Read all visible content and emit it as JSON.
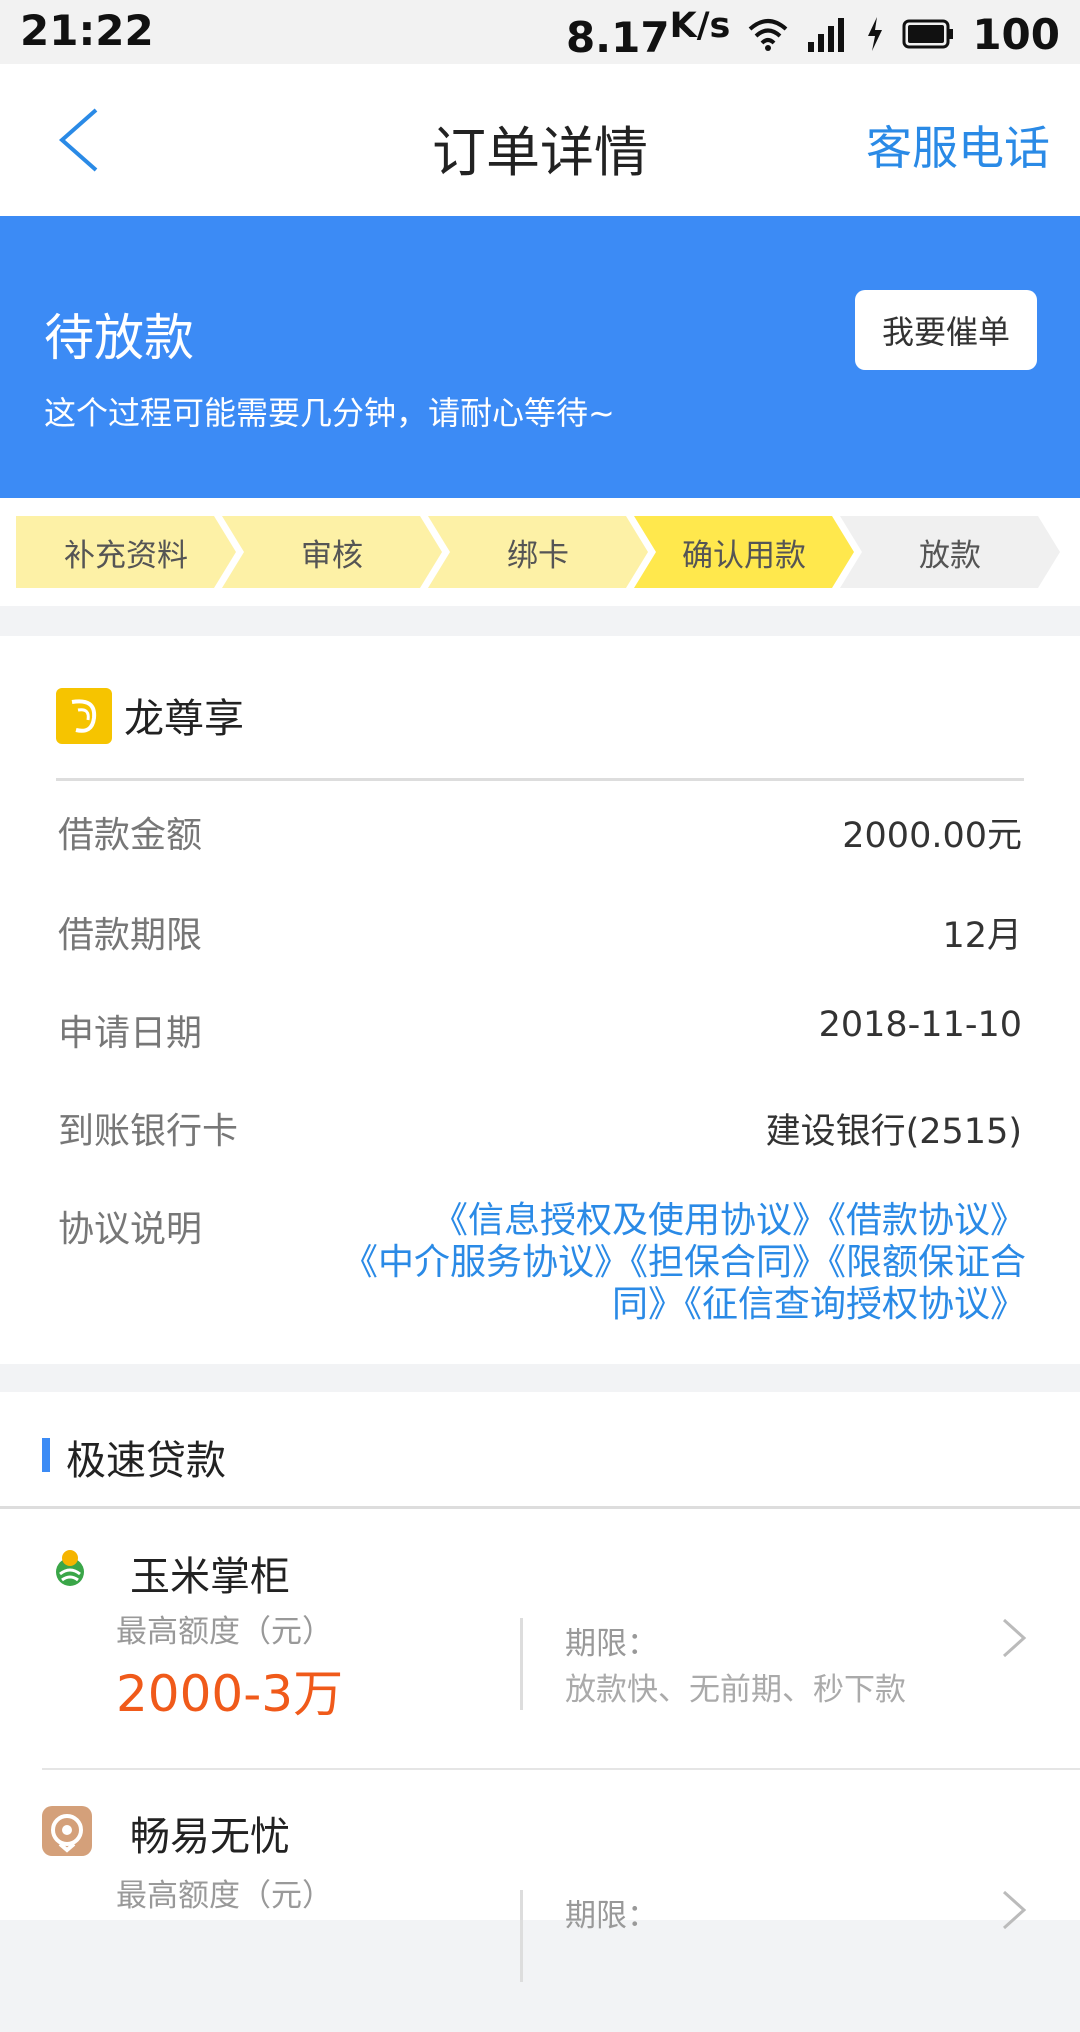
{
  "statusbar": {
    "time": "21:22",
    "speed": "8.17",
    "speed_unit": "K/s",
    "battery": "100"
  },
  "nav": {
    "title": "订单详情",
    "service_label": "客服电话"
  },
  "banner": {
    "title": "待放款",
    "desc": "这个过程可能需要几分钟，请耐心等待~",
    "urge_label": "我要催单",
    "color": "#3c8bf5"
  },
  "steps": [
    {
      "label": "补充资料",
      "state": "done"
    },
    {
      "label": "审核",
      "state": "done"
    },
    {
      "label": "绑卡",
      "state": "done"
    },
    {
      "label": "确认用款",
      "state": "current"
    },
    {
      "label": "放款",
      "state": "pending"
    }
  ],
  "order": {
    "product_name": "龙尊享",
    "rows": [
      {
        "label": "借款金额",
        "value": "2000.00元"
      },
      {
        "label": "借款期限",
        "value": "12月"
      },
      {
        "label": "申请日期",
        "value": "2018-11-10"
      },
      {
        "label": "到账银行卡",
        "value": "建设银行(2515)"
      }
    ],
    "agreement_label": "协议说明",
    "agreements": [
      "《信息授权及使用协议》",
      "《借款协议》",
      "《中介服务协议》",
      "《担保合同》",
      "《限额保证合同》",
      "《征信查询授权协议》"
    ]
  },
  "fast_loans": {
    "title": "极速贷款",
    "items": [
      {
        "name": "玉米掌柜",
        "max_label": "最高额度（元）",
        "amount": "2000-3万",
        "term_label": "期限：",
        "desc": "放款快、无前期、秒下款"
      },
      {
        "name": "畅易无忧",
        "max_label": "最高额度（元）",
        "amount": "",
        "term_label": "期限：",
        "desc": ""
      }
    ]
  },
  "colors": {
    "accent": "#3c8bf5",
    "link": "#2a8ae6",
    "amount": "#f05a1a",
    "step_done": "#fdf1a6",
    "step_current": "#ffe84d",
    "step_pending": "#f0f0f0"
  }
}
